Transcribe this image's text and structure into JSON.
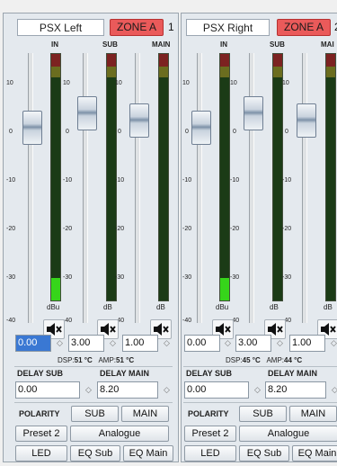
{
  "zones": [
    {
      "name": "PSX Left",
      "zone_label": "ZONE A",
      "zone_number": "1",
      "channels": [
        {
          "label": "IN",
          "unit": "dBu"
        },
        {
          "label": "SUB",
          "unit": "dB"
        },
        {
          "label": "MAIN",
          "unit": "dB"
        }
      ],
      "ticks": [
        "10",
        "0",
        "-10",
        "-20",
        "-30",
        "-40"
      ],
      "gains": [
        "0.00",
        "3.00",
        "1.00"
      ],
      "dsp_label": "DSP:",
      "dsp_temp": "51 °C",
      "amp_label": "AMP:",
      "amp_temp": "51 °C",
      "delay_sub_label": "DELAY SUB",
      "delay_main_label": "DELAY MAIN",
      "delay_sub": "0.00",
      "delay_main": "8.20",
      "polarity_label": "POLARITY",
      "polarity_sub": "SUB",
      "polarity_main": "MAIN",
      "preset": "Preset 2",
      "mode": "Analogue",
      "led": "LED",
      "eq_sub": "EQ Sub",
      "eq_main": "EQ Main",
      "in_meter_level": 0.09
    },
    {
      "name": "PSX Right",
      "zone_label": "ZONE A",
      "zone_number": "2",
      "channels": [
        {
          "label": "IN",
          "unit": "dBu"
        },
        {
          "label": "SUB",
          "unit": "dB"
        },
        {
          "label": "MAI",
          "unit": "dB"
        }
      ],
      "ticks": [
        "10",
        "0",
        "-10",
        "-20",
        "-30",
        "-40"
      ],
      "gains": [
        "0.00",
        "3.00",
        "1.00"
      ],
      "dsp_label": "DSP:",
      "dsp_temp": "45 °C",
      "amp_label": "AMP:",
      "amp_temp": "44 °C",
      "delay_sub_label": "DELAY SUB",
      "delay_main_label": "DELAY MAIN",
      "delay_sub": "0.00",
      "delay_main": "8.20",
      "polarity_label": "POLARITY",
      "polarity_sub": "SUB",
      "polarity_main": "MAIN",
      "preset": "Preset 2",
      "mode": "Analogue",
      "led": "LED",
      "eq_sub": "EQ Sub",
      "eq_main": "EQ Main",
      "in_meter_level": 0.09
    }
  ],
  "icons": {
    "mute": "speaker-mute-icon",
    "spin": "spin-updown-icon"
  },
  "colors": {
    "zone": "#ea5a5a",
    "selected": "#3a78d3",
    "meter_level": "#36d51a"
  }
}
